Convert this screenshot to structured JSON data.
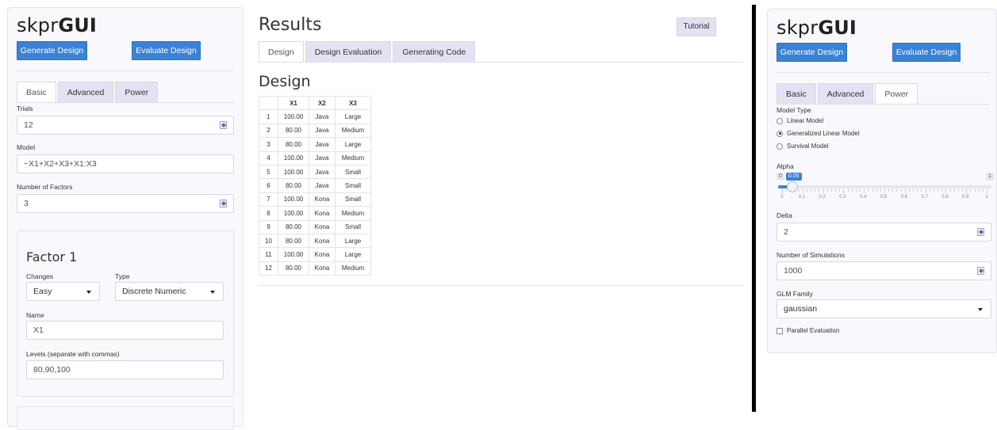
{
  "left": {
    "brand_light": "skpr",
    "brand_bold": "GUI",
    "generate_label": "Generate Design",
    "evaluate_label": "Evaluate Design",
    "tabs": [
      {
        "label": "Basic"
      },
      {
        "label": "Advanced"
      },
      {
        "label": "Power"
      }
    ],
    "active_tab": "Basic",
    "trials_label": "Trials",
    "trials_value": "12",
    "model_label": "Model",
    "model_value": "~X1+X2+X3+X1:X3",
    "factors_label": "Number of Factors",
    "factors_value": "3",
    "factor_card": {
      "title": "Factor 1",
      "changes_label": "Changes",
      "changes_value": "Easy",
      "type_label": "Type",
      "type_value": "Discrete Numeric",
      "name_label": "Name",
      "name_value": "X1",
      "levels_label": "Levels (separate with commas)",
      "levels_value": "80,90,100"
    }
  },
  "center": {
    "title": "Results",
    "tutorial_label": "Tutorial",
    "tabs": [
      {
        "label": "Design"
      },
      {
        "label": "Design Evaluation"
      },
      {
        "label": "Generating Code"
      }
    ],
    "active_tab": "Design",
    "section_title": "Design",
    "table": {
      "headers": [
        "",
        "X1",
        "X2",
        "X3"
      ],
      "rows": [
        [
          "1",
          "100.00",
          "Java",
          "Large"
        ],
        [
          "2",
          "80.00",
          "Java",
          "Medium"
        ],
        [
          "3",
          "80.00",
          "Java",
          "Large"
        ],
        [
          "4",
          "100.00",
          "Java",
          "Medium"
        ],
        [
          "5",
          "100.00",
          "Java",
          "Small"
        ],
        [
          "6",
          "80.00",
          "Java",
          "Small"
        ],
        [
          "7",
          "100.00",
          "Kona",
          "Small"
        ],
        [
          "8",
          "100.00",
          "Kona",
          "Medium"
        ],
        [
          "9",
          "80.00",
          "Kona",
          "Small"
        ],
        [
          "10",
          "80.00",
          "Kona",
          "Large"
        ],
        [
          "11",
          "100.00",
          "Kona",
          "Large"
        ],
        [
          "12",
          "80.00",
          "Kona",
          "Medium"
        ]
      ]
    }
  },
  "right": {
    "brand_light": "skpr",
    "brand_bold": "GUI",
    "generate_label": "Generate Design",
    "evaluate_label": "Evaluate Design",
    "tabs": [
      {
        "label": "Basic"
      },
      {
        "label": "Advanced"
      },
      {
        "label": "Power"
      }
    ],
    "active_tab": "Power",
    "model_type_label": "Model Type",
    "model_types": [
      {
        "label": "Linear Model",
        "selected": false
      },
      {
        "label": "Generalized Linear Model",
        "selected": true
      },
      {
        "label": "Survival Model",
        "selected": false
      }
    ],
    "alpha_label": "Alpha",
    "alpha_min": "0",
    "alpha_max": "1",
    "alpha_value": "0.05",
    "alpha_fraction": 0.05,
    "alpha_ticks": [
      "0",
      "0.1",
      "0.2",
      "0.3",
      "0.4",
      "0.5",
      "0.6",
      "0.7",
      "0.8",
      "0.9",
      "1"
    ],
    "delta_label": "Delta",
    "delta_value": "2",
    "nsim_label": "Number of Simulations",
    "nsim_value": "1000",
    "glm_label": "GLM Family",
    "glm_value": "gaussian",
    "parallel_label": "Parallel Evaluation",
    "parallel_checked": false
  },
  "colors": {
    "accent": "#3a82d6",
    "tab_bg": "#e2e2f2",
    "panel_bg": "#f9f9fd"
  }
}
